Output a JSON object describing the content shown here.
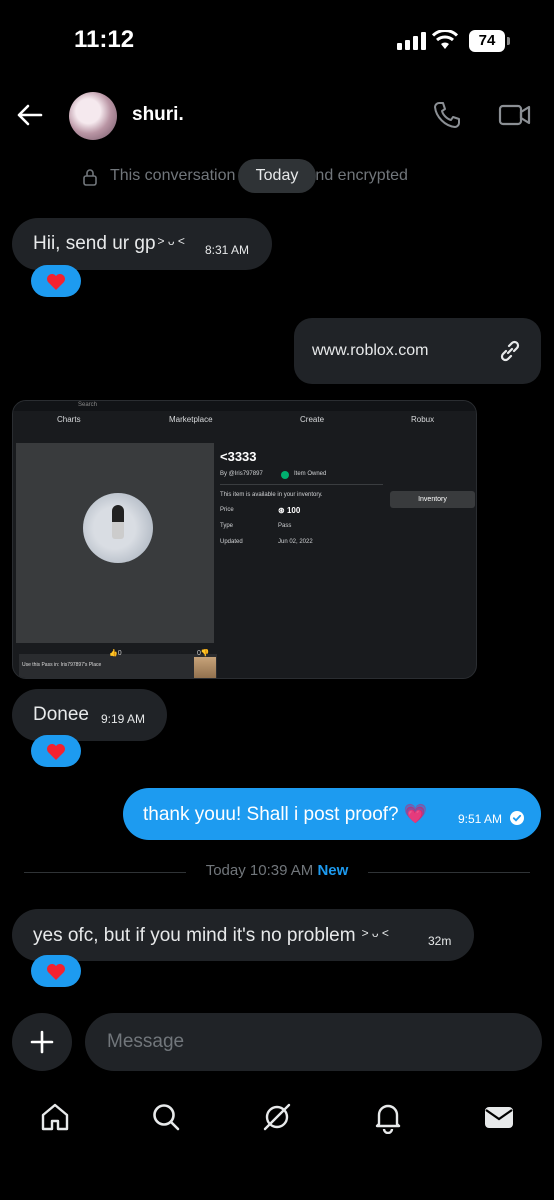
{
  "status_bar": {
    "time": "11:12",
    "battery": "74"
  },
  "header": {
    "contact_name": "shuri."
  },
  "encryption": {
    "notice": "This conversation is end-to-end encrypted",
    "day_pill": "Today"
  },
  "messages": [
    {
      "text": "Hii, send ur gp",
      "emoticon": "> ᴗ <",
      "time": "8:31 AM",
      "reaction": "heart"
    },
    {
      "link": "www.roblox.com"
    },
    {
      "image": {
        "nav": [
          "Charts",
          "Marketplace",
          "Create",
          "Robux"
        ],
        "search": "Search",
        "title": "<3333",
        "by": "By @Iris797897",
        "owned": "Item Owned",
        "inventory_note": "This item is available in your inventory.",
        "inventory_button": "Inventory",
        "price_label": "Price",
        "price_value": "100",
        "type_label": "Type",
        "type_value": "Pass",
        "updated_label": "Updated",
        "updated_value": "Jun 02, 2022",
        "use_pass": "Use this Pass in: Iris797897's Place",
        "upvotes": "0",
        "downvotes": "0"
      }
    },
    {
      "text": "Donee",
      "time": "9:19 AM",
      "reaction": "heart"
    },
    {
      "text": "thank youu! Shall i post proof? 💗",
      "time": "9:51 AM",
      "status": "read"
    },
    {
      "text": "yes ofc, but if you mind it's no problem",
      "emoticon": "> ᴗ <",
      "time": "32m",
      "reaction": "heart"
    }
  ],
  "divider": {
    "label": "Today 10:39 AM",
    "badge": "New"
  },
  "composer": {
    "placeholder": "Message"
  },
  "tabs": [
    "home-icon",
    "search-icon",
    "grok-icon",
    "notifications-icon",
    "messages-icon"
  ],
  "colors": {
    "accent": "#1d9bf0",
    "bubble": "#202327",
    "background": "#000000",
    "heart": "#f91880"
  }
}
